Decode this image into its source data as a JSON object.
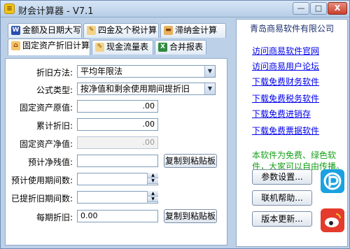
{
  "window": {
    "title": "财会计算器 - V7.1",
    "app_icon": "calculator-icon",
    "minimize": "—",
    "maximize": "□",
    "close": "X"
  },
  "tabs_row1": [
    {
      "label": "金额及日期大写",
      "icon": "word-doc-icon"
    },
    {
      "label": "四金及个税计算",
      "icon": "pencil-icon"
    },
    {
      "label": "滞纳金计算",
      "icon": "cake-icon"
    }
  ],
  "tabs_row2": [
    {
      "label": "固定资产折旧计算",
      "icon": "house-icon",
      "active": true
    },
    {
      "label": "现金流量表",
      "icon": "pencil-icon"
    },
    {
      "label": "合并报表",
      "icon": "spreadsheet-icon"
    }
  ],
  "form": {
    "method_label": "折旧方法:",
    "method_value": "平均年限法",
    "formula_label": "公式类型:",
    "formula_value": "按净值和剩余使用期间提折旧",
    "original_label": "固定资产原值:",
    "original_value": ".00",
    "accumulated_label": "累计折旧:",
    "accumulated_value": ".00",
    "net_label": "固定资产净值:",
    "net_value": ".00",
    "residual_label": "预计净残值:",
    "residual_value": "",
    "life_label": "预计使用期间数:",
    "life_value": "",
    "depreciated_label": "已提折旧期间数:",
    "depreciated_value": "",
    "monthly_label": "每期折旧:",
    "monthly_value": "0.00",
    "copy_button": "复制到粘贴板"
  },
  "sidebar": {
    "heading": "青岛商易软件有限公司",
    "links": [
      "访问商易软件官网",
      "访问商易用户论坛",
      "下载免费财务软件",
      "下载免费税务软件",
      "下载免费进销存",
      "下载免费票据软件"
    ],
    "note": "本软件为免费、绿色软件，大家可以自由传播。",
    "buttons": [
      "参数设置...",
      "联机帮助...",
      "版本更新..."
    ],
    "badges": [
      {
        "icon": "p-logo-icon",
        "color": "#1aa1e0"
      },
      {
        "icon": "weibo-icon",
        "color": "#e43b2c"
      }
    ]
  }
}
